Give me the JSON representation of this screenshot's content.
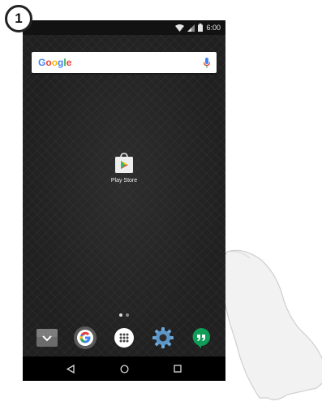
{
  "step_badge": {
    "number": "1"
  },
  "status_bar": {
    "time": "6:00",
    "icons": [
      "wifi-icon",
      "signal-icon",
      "battery-icon"
    ]
  },
  "search": {
    "logo_text": "Google",
    "logo_colors": [
      "#4285F4",
      "#EA4335",
      "#FBBC05",
      "#4285F4",
      "#34A853",
      "#EA4335"
    ],
    "mic_icon": "mic-icon"
  },
  "home": {
    "apps": [
      {
        "label": "Play Store",
        "icon": "play-store-icon"
      }
    ],
    "page_indicator": {
      "pages": 2,
      "current": 1
    }
  },
  "dock": {
    "items": [
      {
        "name": "downloads",
        "icon": "downloads-icon"
      },
      {
        "name": "google",
        "icon": "google-icon"
      },
      {
        "name": "app-drawer",
        "icon": "app-drawer-icon"
      },
      {
        "name": "settings",
        "icon": "settings-icon"
      },
      {
        "name": "hangouts",
        "icon": "hangouts-icon"
      }
    ]
  },
  "nav_bar": {
    "buttons": [
      "back-icon",
      "home-icon",
      "recents-icon"
    ]
  },
  "colors": {
    "status_bar": "#121212",
    "nav_bar": "#000000",
    "wallpaper": "#202020"
  }
}
